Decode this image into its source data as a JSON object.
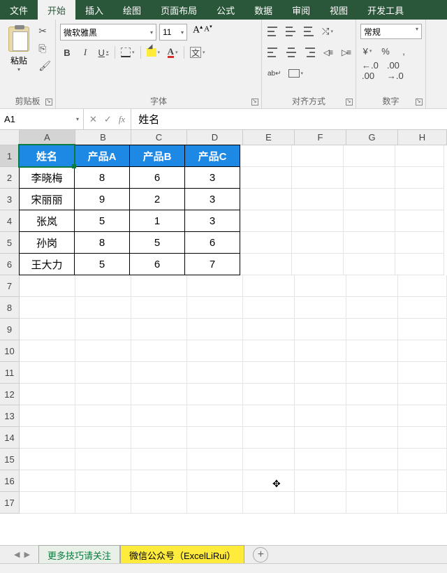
{
  "tabs": [
    "文件",
    "开始",
    "插入",
    "绘图",
    "页面布局",
    "公式",
    "数据",
    "审阅",
    "视图",
    "开发工具"
  ],
  "activeTab": 1,
  "clipboard": {
    "paste": "粘贴",
    "groupLabel": "剪贴板"
  },
  "font": {
    "name": "微软雅黑",
    "size": "11",
    "bold": "B",
    "italic": "I",
    "underline": "U",
    "groupLabel": "字体"
  },
  "align": {
    "groupLabel": "对齐方式"
  },
  "number": {
    "format": "常规",
    "percent": "%",
    "comma": ",",
    "inc": ".0",
    "dec": ".00",
    "groupLabel": "数字",
    "currency": "¥"
  },
  "nameBox": "A1",
  "formulaValue": "姓名",
  "columns": [
    "A",
    "B",
    "C",
    "D",
    "E",
    "F",
    "G",
    "H"
  ],
  "rows": [
    "1",
    "2",
    "3",
    "4",
    "5",
    "6",
    "7",
    "8",
    "9",
    "10",
    "11",
    "12",
    "13",
    "14",
    "15",
    "16",
    "17"
  ],
  "chart_data": {
    "type": "table",
    "headers": [
      "姓名",
      "产品A",
      "产品B",
      "产品C"
    ],
    "data": [
      {
        "姓名": "李晓梅",
        "产品A": 8,
        "产品B": 6,
        "产品C": 3
      },
      {
        "姓名": "宋丽丽",
        "产品A": 9,
        "产品B": 2,
        "产品C": 3
      },
      {
        "姓名": "张岚",
        "产品A": 5,
        "产品B": 1,
        "产品C": 3
      },
      {
        "姓名": "孙岗",
        "产品A": 8,
        "产品B": 5,
        "产品C": 6
      },
      {
        "姓名": "王大力",
        "产品A": 5,
        "产品B": 6,
        "产品C": 7
      }
    ]
  },
  "sheetTabs": {
    "tab1": "更多技巧请关注",
    "tab2": "微信公众号（ExcelLiRui）"
  }
}
